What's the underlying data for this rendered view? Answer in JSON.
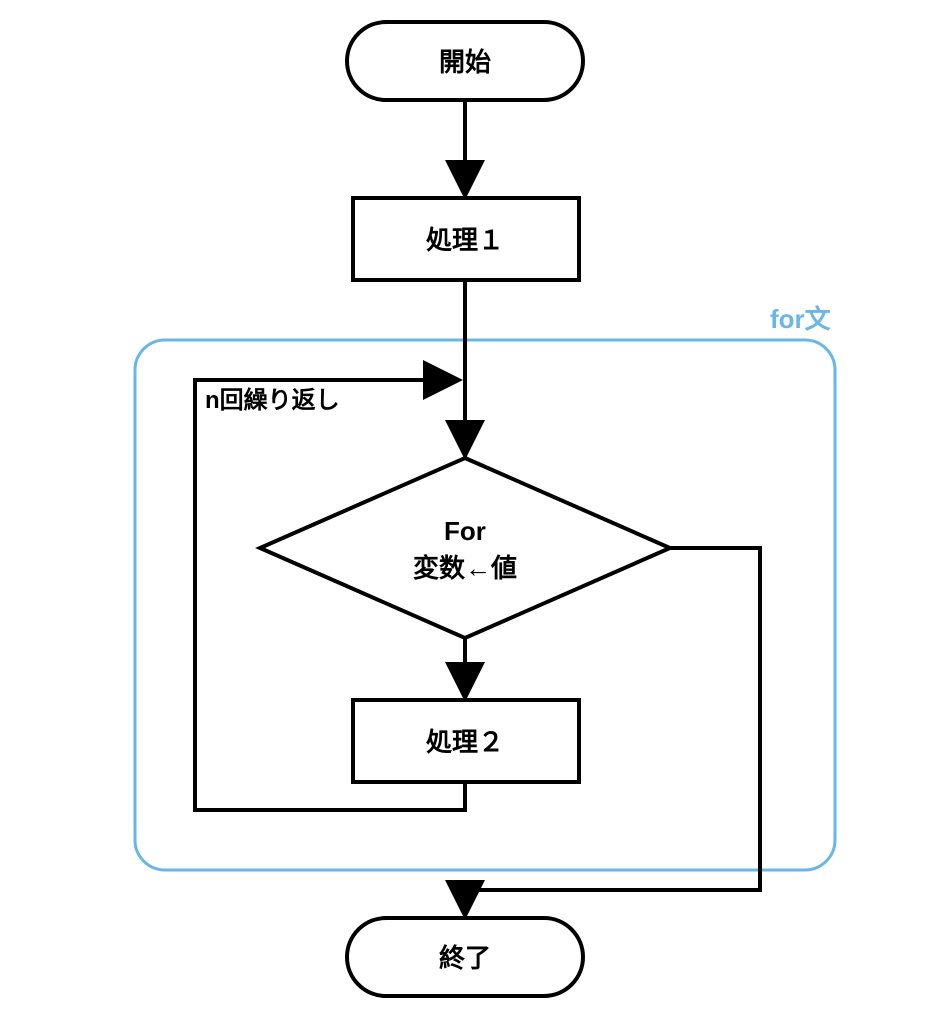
{
  "start": "開始",
  "process1": "処理１",
  "decision_line1": "For",
  "decision_line2": "変数←値",
  "loop_label": "n回繰り返し",
  "process2": "処理２",
  "end": "終了",
  "for_box_label": "for文",
  "accent_color": "#6bb6e8"
}
